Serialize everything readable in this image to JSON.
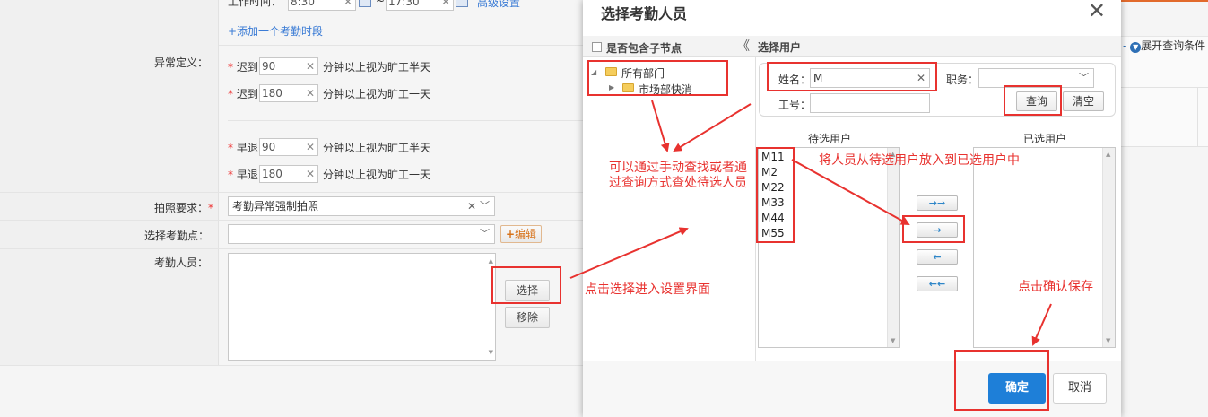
{
  "background": {
    "work_time_prefix": "工作时间：",
    "work_start": "8:30",
    "work_tilde": "~",
    "work_end": "17:30",
    "advanced_link": "高级设置",
    "add_period_link": "+添加一个考勤时段",
    "anomaly_label": "异常定义：",
    "late_prefix": "迟到",
    "early_prefix": "早退",
    "late_rows": [
      {
        "value": "90",
        "suffix": "分钟以上视为旷工半天"
      },
      {
        "value": "180",
        "suffix": "分钟以上视为旷工一天"
      }
    ],
    "early_rows": [
      {
        "value": "90",
        "suffix": "分钟以上视为旷工半天"
      },
      {
        "value": "180",
        "suffix": "分钟以上视为旷工一天"
      }
    ],
    "photo_label": "拍照要求：",
    "photo_value": "考勤异常强制拍照",
    "point_label": "选择考勤点：",
    "edit_button": "编辑",
    "person_label": "考勤人员：",
    "select_button": "选择",
    "remove_button": "移除",
    "expand_query": "展开查询条件"
  },
  "modal": {
    "title": "选择考勤人员",
    "include_children": "是否包含子节点",
    "select_user_header": "选择用户",
    "tree": {
      "root": "所有部门",
      "child": "市场部快消"
    },
    "search": {
      "name_label": "姓名：",
      "name_value": "M",
      "title_label": "职务：",
      "id_label": "工号：",
      "id_value": "",
      "query_button": "查询",
      "clear_button": "清空"
    },
    "pending_title": "待选用户",
    "selected_title": "已选用户",
    "pending_users": [
      "M11",
      "M2",
      "M22",
      "M33",
      "M44",
      "M55"
    ],
    "selected_users": [],
    "ok_button": "确定",
    "cancel_button": "取消"
  },
  "annotations": {
    "note_search": "可以通过手动查找或者通过查询方式查处待选人员",
    "note_move": "将人员从待选用户放入到已选用户中",
    "note_select": "点击选择进入设置界面",
    "note_confirm": "点击确认保存"
  },
  "colors": {
    "annotation_red": "#e8322f",
    "primary_blue": "#1e7fd8",
    "folder_yellow": "#f5cd5c"
  }
}
